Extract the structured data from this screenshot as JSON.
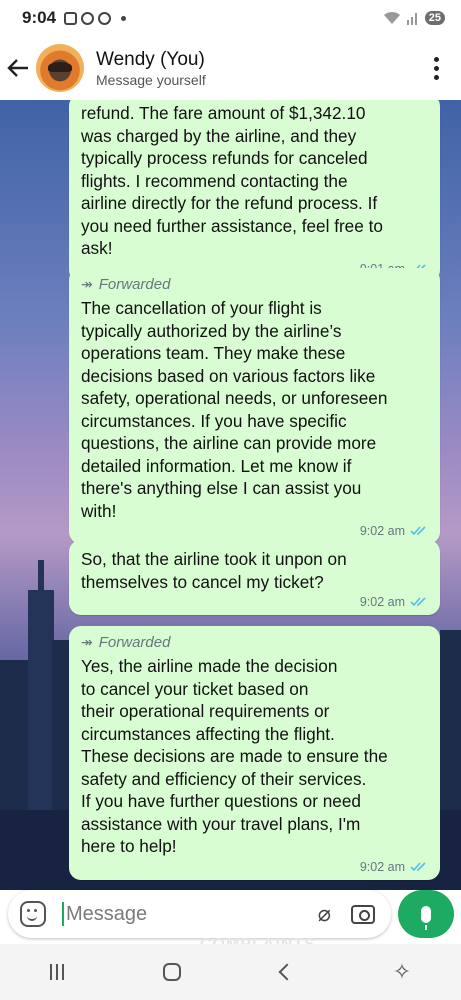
{
  "status": {
    "time": "9:04",
    "battery": "25"
  },
  "header": {
    "name": "Wendy (You)",
    "subtitle": "Message yourself"
  },
  "messages": [
    {
      "forwarded": false,
      "text": "refund. The fare amount of $1,342.10\nwas charged by the airline, and they\ntypically process refunds for canceled\nflights. I recommend contacting the\nairline directly for the refund process. If\nyou need further assistance, feel free to\nask!",
      "time": "9:01 am"
    },
    {
      "forwarded": true,
      "forwarded_label": "Forwarded",
      "text": "The cancellation of your flight is\ntypically authorized by the airline’s\noperations team. They make these\ndecisions based on various factors like\nsafety, operational needs, or unforeseen\ncircumstances. If you have specific\nquestions, the airline can provide more\ndetailed information. Let me know if\nthere's anything else I can assist you\nwith!",
      "time": "9:02 am"
    },
    {
      "forwarded": false,
      "text": "So,  that the airline took it unpon on\nthemselves  to cancel my ticket?",
      "time": "9:02 am"
    },
    {
      "forwarded": true,
      "forwarded_label": "Forwarded",
      "text": "Yes, the airline made the decision\nto cancel your ticket based on\ntheir operational requirements or\ncircumstances affecting the flight.\nThese decisions are made to ensure the\nsafety and efficiency of their services.\nIf you have further questions or need\nassistance with your travel plans, I'm\nhere to help!",
      "time": "9:02 am"
    }
  ],
  "input": {
    "placeholder": "Message"
  },
  "watermark": "COMPLAINTS",
  "colors": {
    "bubble": "#d9fdd3",
    "accent": "#1daa61",
    "tick": "#53bdeb"
  },
  "icons": [
    "back-arrow-icon",
    "menu-dots-icon",
    "forward-icon",
    "double-check-icon",
    "emoji-icon",
    "attach-icon",
    "camera-icon",
    "mic-icon"
  ]
}
